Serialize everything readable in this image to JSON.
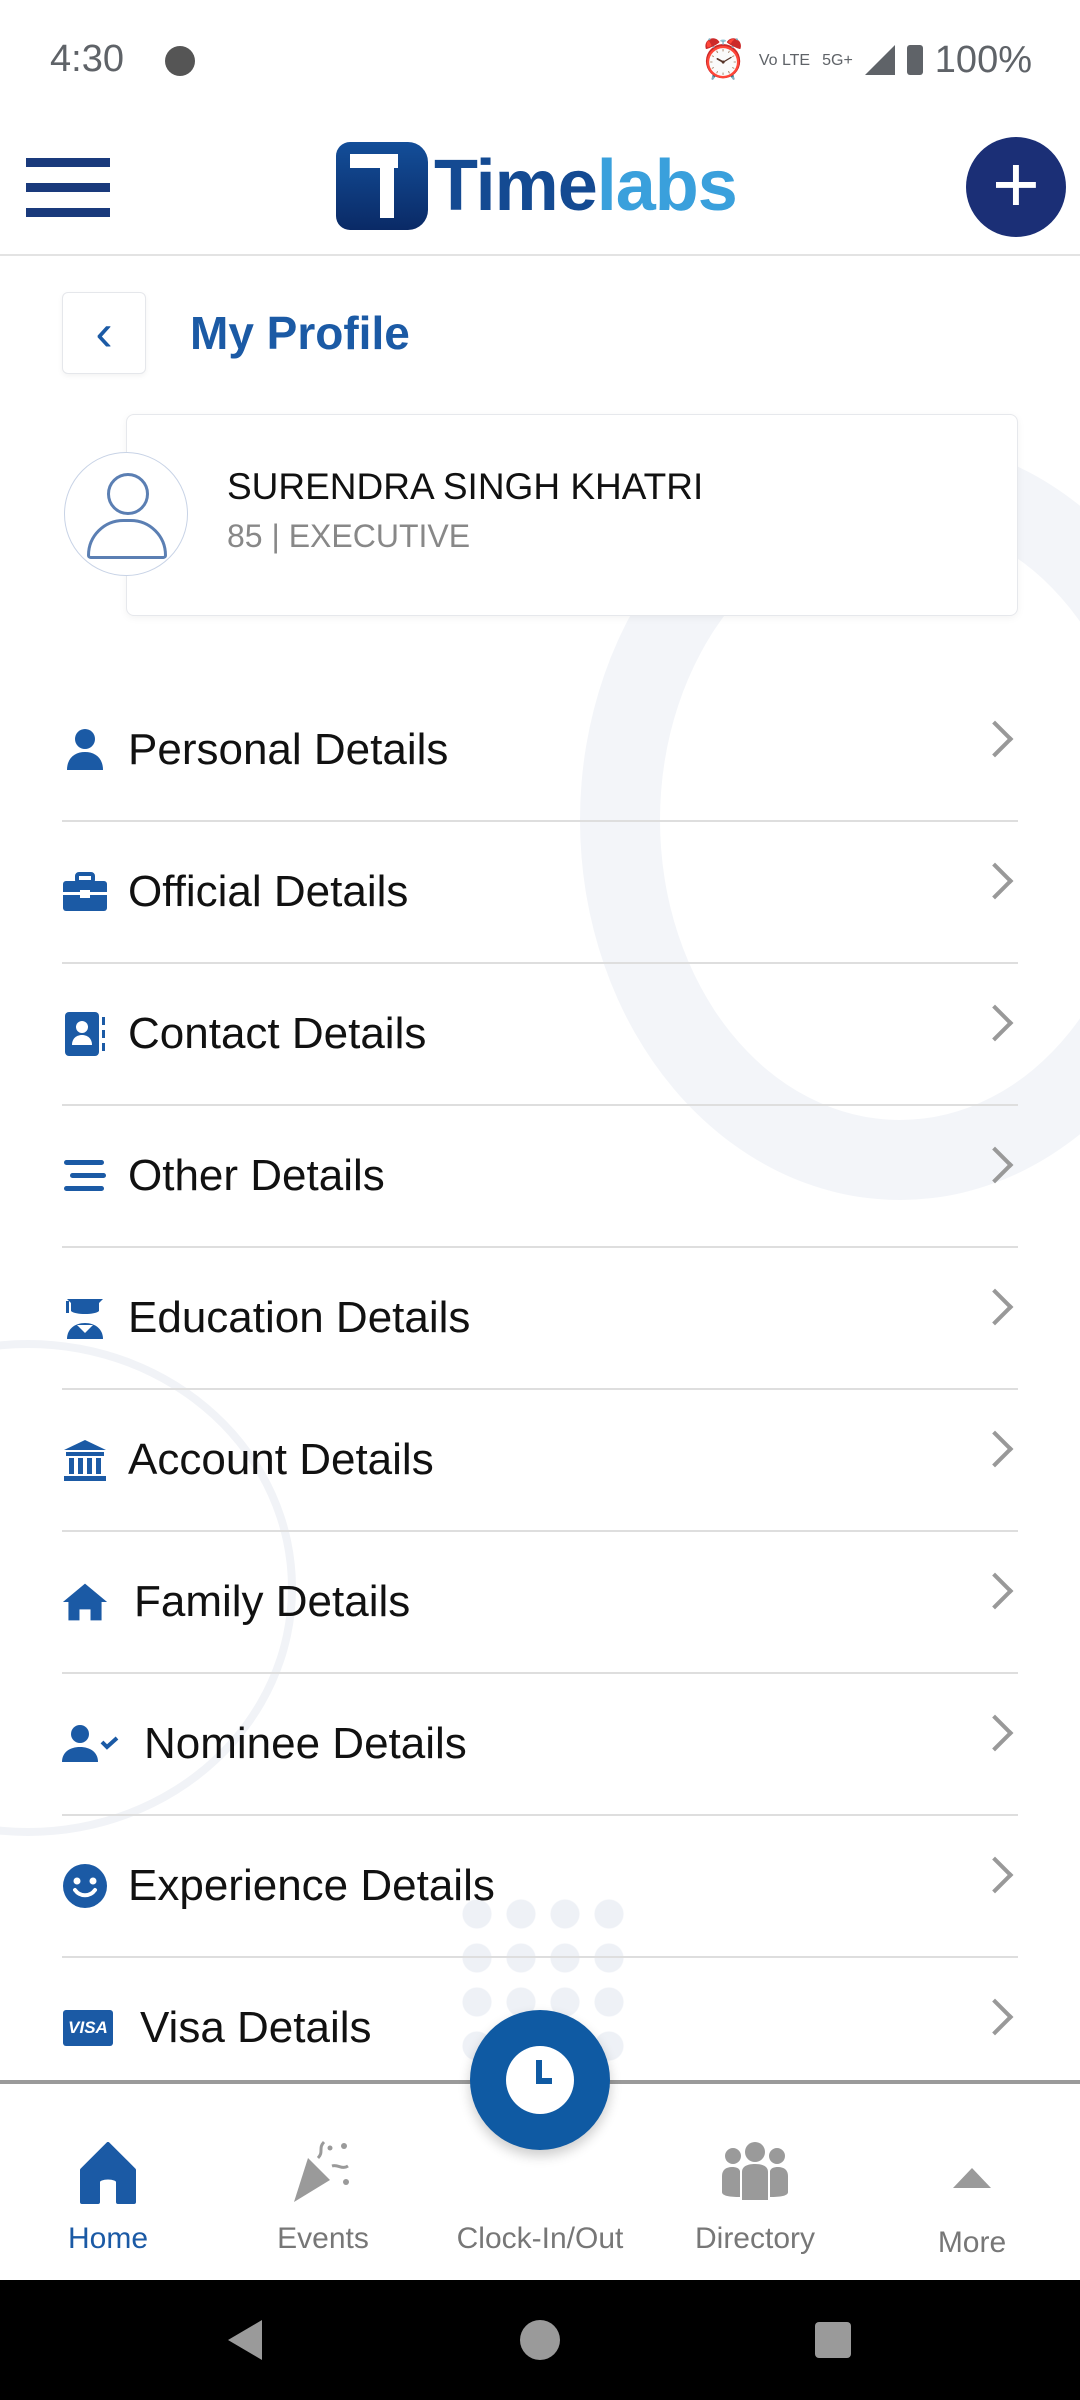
{
  "status_bar": {
    "time": "4:30",
    "volte": "Vo LTE",
    "network": "5G+",
    "battery": "100%"
  },
  "app_bar": {
    "logo_part1": "Time",
    "logo_part2": "labs",
    "menu_icon": "hamburger-icon",
    "add_icon": "plus-icon"
  },
  "page": {
    "title": "My Profile",
    "back_icon": "chevron-left-icon"
  },
  "profile": {
    "name": "SURENDRA SINGH KHATRI",
    "subtitle": "85 | EXECUTIVE"
  },
  "menu": [
    {
      "label": "Personal Details",
      "icon": "person-icon"
    },
    {
      "label": "Official Details",
      "icon": "briefcase-icon"
    },
    {
      "label": "Contact Details",
      "icon": "contact-book-icon"
    },
    {
      "label": "Other Details",
      "icon": "lines-icon"
    },
    {
      "label": "Education Details",
      "icon": "graduate-icon"
    },
    {
      "label": "Account Details",
      "icon": "bank-icon"
    },
    {
      "label": "Family Details",
      "icon": "home-icon"
    },
    {
      "label": "Nominee Details",
      "icon": "person-check-icon"
    },
    {
      "label": "Experience Details",
      "icon": "smile-icon"
    },
    {
      "label": "Visa Details",
      "icon": "visa-icon"
    }
  ],
  "visa_badge": "VISA",
  "bottom_nav": {
    "home": "Home",
    "events": "Events",
    "clock": "Clock-In/Out",
    "directory": "Directory",
    "more": "More",
    "active": "Home"
  },
  "colors": {
    "primary": "#1b5aa5",
    "navy": "#1b2f76",
    "accent": "#3aa0dc"
  }
}
